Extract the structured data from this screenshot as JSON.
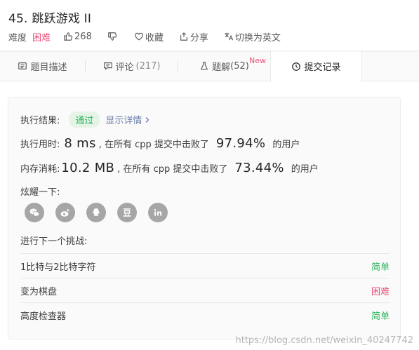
{
  "header": {
    "title": "45. 跳跃游戏 II",
    "difficulty_label": "难度",
    "difficulty": "困难",
    "likes": "268",
    "favorite_label": "收藏",
    "share_label": "分享",
    "switch_lang_label": "切换为英文"
  },
  "tabs": [
    {
      "label": "题目描述",
      "count": "",
      "icon": "description-icon"
    },
    {
      "label": "评论",
      "count": "(217)",
      "icon": "comment-icon"
    },
    {
      "label": "题解",
      "count": "(52)",
      "icon": "solution-icon",
      "badge": "New"
    },
    {
      "label": "提交记录",
      "count": "",
      "icon": "clock-icon",
      "active": true
    }
  ],
  "result": {
    "result_label": "执行结果:",
    "status": "通过",
    "detail_link": "显示详情",
    "runtime_label": "执行用时:",
    "runtime_value": "8 ms",
    "runtime_mid": ", 在所有 cpp 提交中击败了",
    "runtime_pct": "97.94%",
    "runtime_tail": "的用户",
    "memory_label": "内存消耗:",
    "memory_value": "10.2 MB",
    "memory_mid": ", 在所有 cpp 提交中击败了",
    "memory_pct": "73.44%",
    "memory_tail": "的用户",
    "share_title": "炫耀一下:",
    "share_icons": [
      "wechat-icon",
      "weibo-icon",
      "qq-icon",
      "douban-icon",
      "linkedin-icon"
    ]
  },
  "next": {
    "title": "进行下一个挑战:",
    "items": [
      {
        "name": "1比特与2比特字符",
        "level": "简单",
        "level_type": "easy"
      },
      {
        "name": "变为棋盘",
        "level": "困难",
        "level_type": "hard"
      },
      {
        "name": "高度检查器",
        "level": "简单",
        "level_type": "easy"
      }
    ]
  },
  "watermark": "https://blog.csdn.net/weixin_40247742",
  "colors": {
    "easy": "#2db55d",
    "hard": "#ec4c75",
    "pass_bg": "#e6f4e8",
    "link": "#6b7fa8"
  }
}
